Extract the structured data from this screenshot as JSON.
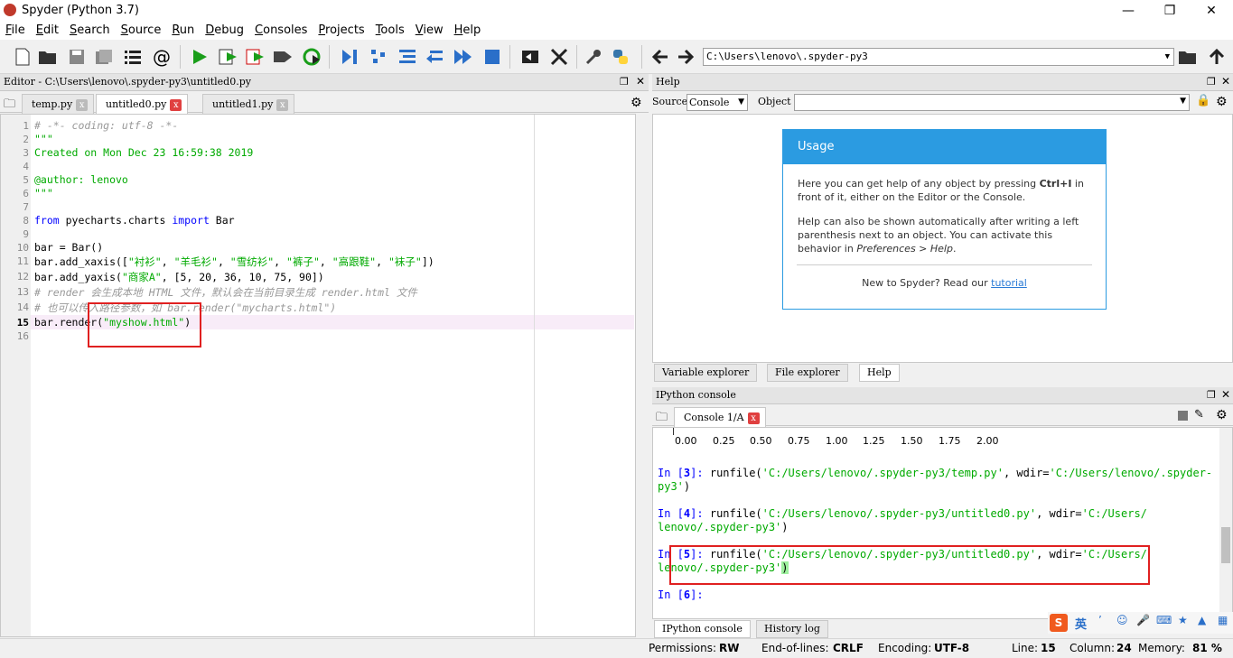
{
  "window": {
    "title": "Spyder (Python 3.7)",
    "minimize": "—",
    "maximize": "❐",
    "close": "✕"
  },
  "menu": [
    "File",
    "Edit",
    "Search",
    "Source",
    "Run",
    "Debug",
    "Consoles",
    "Projects",
    "Tools",
    "View",
    "Help"
  ],
  "toolbar": {
    "icons": [
      "new-file-icon",
      "open-file-icon",
      "save-icon",
      "save-all-icon",
      "outline-icon",
      "at-icon",
      "run-icon",
      "run-cell-icon",
      "run-cell-advance-icon",
      "run-selection-icon",
      "rerun-icon",
      "debug-icon",
      "step-icon",
      "step-into-icon",
      "step-return-icon",
      "continue-icon",
      "stop-icon",
      "maximize-pane-icon",
      "fullscreen-icon",
      "preferences-icon",
      "python-path-icon",
      "back-icon",
      "forward-icon",
      "browse-icon",
      "parent-dir-icon"
    ],
    "path": "C:\\Users\\lenovo\\.spyder-py3"
  },
  "editor": {
    "header": "Editor - C:\\Users\\lenovo\\.spyder-py3\\untitled0.py",
    "tabs": [
      {
        "label": "temp.py"
      },
      {
        "label": "untitled0.py"
      },
      {
        "label": "untitled1.py"
      }
    ],
    "lines": [
      "1",
      "2",
      "3",
      "4",
      "5",
      "6",
      "7",
      "8",
      "9",
      "10",
      "11",
      "12",
      "13",
      "14",
      "15",
      "16"
    ],
    "code": {
      "l1": "# -*- coding: utf-8 -*-",
      "l2": "\"\"\"",
      "l3": "Created on Mon Dec 23 16:59:38 2019",
      "l5": "@author: lenovo",
      "l6": "\"\"\"",
      "l8a": "from",
      "l8b": " pyecharts.charts ",
      "l8c": "import",
      "l8d": " Bar",
      "l10": "bar = Bar()",
      "l11a": "bar.add_xaxis([",
      "l11b": "\"衬衫\"",
      "l11c": ", ",
      "l11d": "\"羊毛衫\"",
      "l11e": ", ",
      "l11f": "\"雪纺衫\"",
      "l11g": ", ",
      "l11h": "\"裤子\"",
      "l11i": ", ",
      "l11j": "\"高跟鞋\"",
      "l11k": ", ",
      "l11l": "\"袜子\"",
      "l11m": "])",
      "l12a": "bar.add_yaxis(",
      "l12b": "\"商家A\"",
      "l12c": ", [5, 20, 36, 10, 75, 90])",
      "l13": "# render 会生成本地 HTML 文件，默认会在当前目录生成 render.html 文件",
      "l14": "# 也可以传入路径参数，如 bar.render(\"mycharts.html\")",
      "l15a": "bar.render(",
      "l15b": "\"myshow.html\"",
      "l15c": ")"
    }
  },
  "help": {
    "header": "Help",
    "source_label": "Source",
    "source_value": "Console",
    "object_label": "Object",
    "usage_title": "Usage",
    "usage_p1a": "Here you can get help of any object by pressing ",
    "usage_p1b": "Ctrl+I",
    "usage_p1c": " in front of it, either on the Editor or the Console.",
    "usage_p2a": "Help can also be shown automatically after writing a left parenthesis next to an object. You can activate this behavior in ",
    "usage_p2b": "Preferences > Help",
    "usage_p2c": ".",
    "usage_p3a": "New to Spyder? Read our ",
    "usage_p3b": "tutorial",
    "tabs": [
      "Variable explorer",
      "File explorer",
      "Help"
    ]
  },
  "console": {
    "header": "IPython console",
    "tab": "Console 1/A",
    "axis_ticks": [
      "0.00",
      "0.25",
      "0.50",
      "0.75",
      "1.00",
      "1.25",
      "1.50",
      "1.75",
      "2.00"
    ],
    "entries": [
      {
        "n": "3",
        "l1a": "runfile(",
        "l1b": "'C:/Users/lenovo/.spyder-py3/temp.py'",
        "l1c": ", wdir=",
        "l1d": "'C:/Users/lenovo/.spyder-",
        "l2": "py3'",
        "l2c": ")"
      },
      {
        "n": "4",
        "l1a": "runfile(",
        "l1b": "'C:/Users/lenovo/.spyder-py3/untitled0.py'",
        "l1c": ", wdir=",
        "l1d": "'C:/Users/",
        "l2": "lenovo/.spyder-py3'",
        "l2c": ")"
      },
      {
        "n": "5",
        "l1a": "runfile(",
        "l1b": "'C:/Users/lenovo/.spyder-py3/untitled0.py'",
        "l1c": ", wdir=",
        "l1d": "'C:/Users/",
        "l2": "lenovo/.spyder-py3'",
        "l2c": ")"
      }
    ],
    "prompt6": "6",
    "in_label": "In ",
    "tabs": [
      "IPython console",
      "History log"
    ]
  },
  "status": {
    "permissions_label": "Permissions:",
    "permissions": "RW",
    "eol_label": "End-of-lines:",
    "eol": "CRLF",
    "encoding_label": "Encoding:",
    "encoding": "UTF-8",
    "line_label": "Line:",
    "line": "15",
    "column_label": "Column:",
    "column": "24",
    "memory_label": "Memory:",
    "memory": "81 %"
  },
  "ime": {
    "lang": "英"
  }
}
